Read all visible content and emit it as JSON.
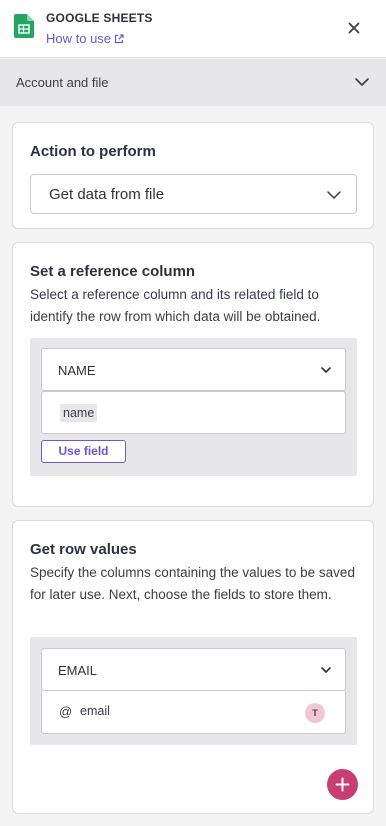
{
  "header": {
    "app_title": "GOOGLE SHEETS",
    "help_link": "How to use",
    "close_icon": "close-icon",
    "app_icon": "google-sheets-icon"
  },
  "section": {
    "label": "Account and file",
    "icon": "chevron-down-icon"
  },
  "action_card": {
    "title": "Action to perform",
    "selected": "Get data from file"
  },
  "reference_card": {
    "title": "Set a reference column",
    "description": "Select a reference column and its related field to identify the row from which data will be obtained.",
    "column_select": "NAME",
    "field_chip": "name",
    "use_field_button": "Use field"
  },
  "row_values_card": {
    "title": "Get row values",
    "description": "Specify the columns containing the values to be saved for later use. Next, choose the fields to store them.",
    "column_select": "EMAIL",
    "field_prefix": "@",
    "field_value": "email",
    "avatar_letter": "T",
    "add_icon": "plus-icon"
  },
  "colors": {
    "accent": "#6e56cf",
    "add_button": "#c83e73",
    "sheets_green": "#23a566"
  }
}
